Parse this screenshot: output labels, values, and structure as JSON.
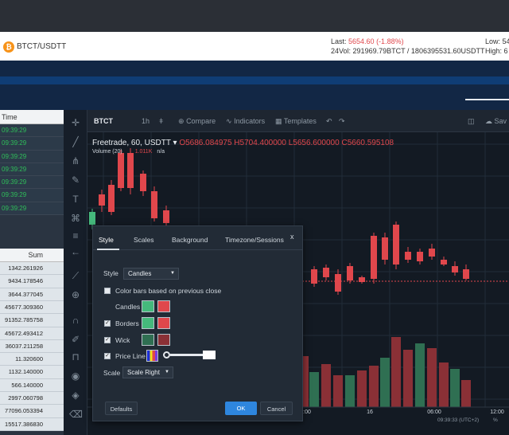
{
  "header": {
    "pair": "BTCT/USDTT",
    "last_label": "Last:",
    "last_value": "5654.60 (-1.88%)",
    "vol_label": "24Vol:",
    "vol_value": "291969.79BTCT / 1806395531.60USDTT",
    "low": "Low: 54",
    "high": "High: 6"
  },
  "left_panel": {
    "time_header": "Time",
    "times": [
      "09:39:29",
      "09:39:29",
      "09:39:29",
      "09:39:29",
      "09:39:29",
      "09:39:29",
      "09:39:29"
    ],
    "sum_header": "Sum",
    "sums": [
      "1342.261926",
      "9434.178546",
      "3644.377045",
      "45677.309360",
      "91352.785758",
      "45672.493412",
      "36037.211258",
      "11.320600",
      "1132.140000",
      "566.140000",
      "2997.060798",
      "77096.053394",
      "15517.386830"
    ]
  },
  "chart_toolbar": {
    "symbol": "BTCT",
    "interval": "1h",
    "compare": "Compare",
    "indicators": "Indicators",
    "templates": "Templates",
    "save": "Sav"
  },
  "legend": {
    "title": "Freetrade, 60, USDTT",
    "o_label": "O",
    "o": "5686.084975",
    "h_label": "H",
    "h": "5704.400000",
    "l_label": "L",
    "l": "5656.600000",
    "c_label": "C",
    "c": "5660.595108",
    "volume": "Volume (20)",
    "vol_value": "1.011K",
    "vol_na": "n/a"
  },
  "x_axis": {
    "labels": [
      ":00",
      "16",
      "06:00",
      "12:00"
    ],
    "time_readout": "09:39:33 (UTC+2)",
    "percent": "%"
  },
  "dialog": {
    "tabs": [
      "Style",
      "Scales",
      "Background",
      "Timezone/Sessions"
    ],
    "close": "x",
    "style_label": "Style",
    "style_value": "Candles",
    "color_bars_label": "Color bars based on previous close",
    "candles_label": "Candles",
    "borders_label": "Borders",
    "wick_label": "Wick",
    "price_line_label": "Price Line",
    "scale_label": "Scale",
    "scale_value": "Scale Right",
    "defaults": "Defaults",
    "ok": "OK",
    "cancel": "Cancel",
    "colors": {
      "up": "#45b97c",
      "down": "#e0474c",
      "wick_up": "#2f6f52",
      "wick_down": "#8a3036"
    }
  },
  "chart_data": {
    "type": "candlestick",
    "x_labels": [
      ":00",
      "16",
      "06:00",
      "12:00"
    ],
    "visible_legend": {
      "open": 5686.084975,
      "high": 5704.4,
      "low": 5656.6,
      "close": 5660.595108
    }
  }
}
